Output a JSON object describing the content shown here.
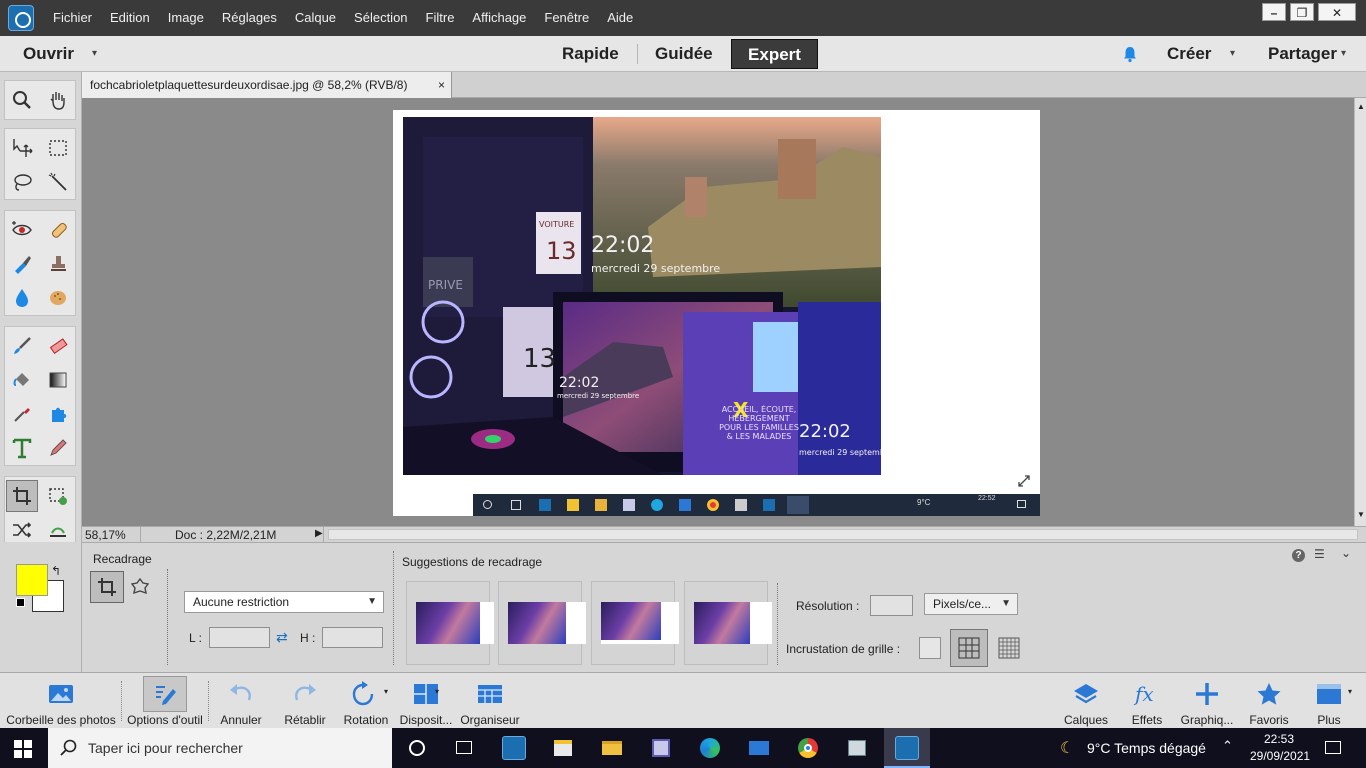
{
  "menubar": {
    "items": [
      "Fichier",
      "Edition",
      "Image",
      "Réglages",
      "Calque",
      "Sélection",
      "Filtre",
      "Affichage",
      "Fenêtre",
      "Aide"
    ]
  },
  "modebar": {
    "open_label": "Ouvrir",
    "modes": [
      "Rapide",
      "Guidée",
      "Expert"
    ],
    "create_label": "Créer",
    "share_label": "Partager"
  },
  "document": {
    "tab_title": "fochcabrioletplaquettesurdeuxordisae.jpg @ 58,2% (RVB/8)",
    "close_glyph": "×"
  },
  "photo": {
    "clock_big": "22:02",
    "date_big": "mercredi 29 septembre",
    "clock_small": "22:02",
    "date_small": "mercredi 29 septembre",
    "clock_right": "22:02",
    "date_right": "mercredi 29 septembre",
    "sign_voiture": "VOITURE",
    "sign_number": "13",
    "sign_prive": "PRIVE",
    "number_13b": "13",
    "flyer_text": "ACCUEIL, ÉCOUTE, HÉBERGEMENT POUR LES FAMILLES & LES MALADES"
  },
  "image_taskbar": {
    "weather": "9°C",
    "time": "22:52"
  },
  "statusbar": {
    "zoom": "58,17%",
    "doc_info": "Doc : 2,22M/2,21M"
  },
  "options": {
    "recadrage_label": "Recadrage",
    "restriction_value": "Aucune restriction",
    "l_label": "L :",
    "h_label": "H :",
    "suggestions_label": "Suggestions de recadrage",
    "resolution_label": "Résolution :",
    "resolution_unit": "Pixels/ce...",
    "grid_label": "Incrustation de grille :"
  },
  "colors": {
    "foreground": "#ffff00",
    "background": "#ffffff"
  },
  "bottombar": {
    "items": [
      "Corbeille des photos",
      "Options d'outil",
      "Annuler",
      "Rétablir",
      "Rotation",
      "Disposit...",
      "Organiseur"
    ],
    "right_items": [
      "Calques",
      "Effets",
      "Graphiq...",
      "Favoris",
      "Plus"
    ]
  },
  "wintaskbar": {
    "search_placeholder": "Taper ici pour rechercher",
    "weather": "9°C  Temps dégagé",
    "time": "22:53",
    "date": "29/09/2021"
  }
}
